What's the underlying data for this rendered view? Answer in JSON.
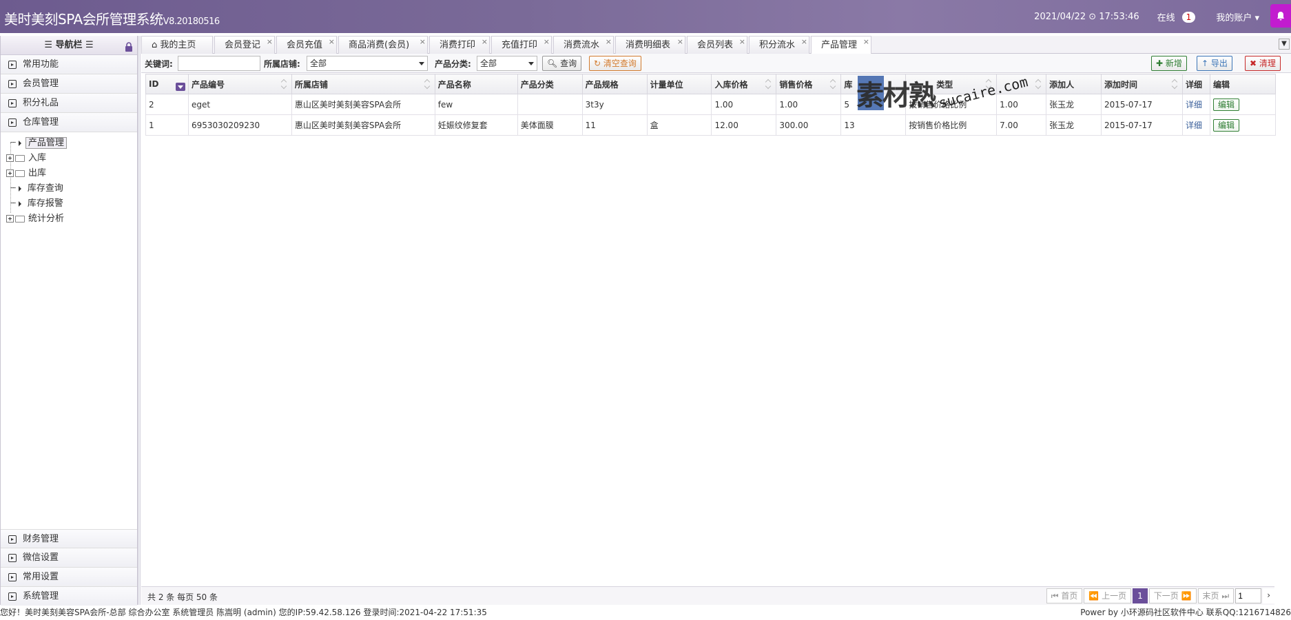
{
  "header": {
    "title": "美时美刻SPA会所管理系统",
    "version": "V8.20180516",
    "datetime": "2021/04/22 ⊙ 17:53:46",
    "online_label": "在线",
    "online_count": "1",
    "account_label": "我的账户"
  },
  "sidebar": {
    "title": "☰ 导航栏 ☰",
    "top_groups": [
      "常用功能",
      "会员管理",
      "积分礼品",
      "仓库管理"
    ],
    "tree": [
      "产品管理",
      "入库",
      "出库",
      "库存查询",
      "库存报警",
      "统计分析"
    ],
    "bottom_groups": [
      "财务管理",
      "微信设置",
      "常用设置",
      "系统管理"
    ]
  },
  "tabs": [
    "我的主页",
    "会员登记",
    "会员充值",
    "商品消费(会员)",
    "消费打印",
    "充值打印",
    "消费流水",
    "消费明细表",
    "会员列表",
    "积分流水",
    "产品管理"
  ],
  "toolbar": {
    "keyword_label": "关键词:",
    "store_label": "所属店铺:",
    "store_value": "全部",
    "category_label": "产品分类:",
    "category_value": "全部",
    "query_button": "查询",
    "clear_button": "清空查询",
    "add_button": "新增",
    "export_button": "导出",
    "clean_button": "清理"
  },
  "table": {
    "headers": [
      "ID",
      "产品编号",
      "所属店铺",
      "产品名称",
      "产品分类",
      "产品规格",
      "计量单位",
      "入库价格",
      "销售价格",
      "库",
      "类型",
      "",
      "添加人",
      "添加时间",
      "详细",
      "编辑"
    ],
    "rows": [
      [
        "2",
        "eget",
        "惠山区美时美刻美容SPA会所",
        "few",
        "",
        "3t3y",
        "",
        "1.00",
        "1.00",
        "5",
        "按销售价格比例",
        "1.00",
        "张玉龙",
        "2015-07-17",
        "详细",
        "编辑"
      ],
      [
        "1",
        "6953030209230",
        "惠山区美时美刻美容SPA会所",
        "妊娠纹修复套",
        "美体面膜",
        "11",
        "盒",
        "12.00",
        "300.00",
        "13",
        "按销售价格比例",
        "7.00",
        "张玉龙",
        "2015-07-17",
        "详细",
        "编辑"
      ]
    ]
  },
  "watermark": {
    "cn": "素材熟",
    "en": "sucaire.com"
  },
  "footer": {
    "summary": "共 2 条 每页 50 条",
    "first": "首页",
    "prev": "上一页",
    "current": "1",
    "next": "下一页",
    "last": "末页",
    "page_input": "1"
  },
  "statusbar": {
    "left": "您好！美时美刻美容SPA会所-总部 综合办公室 系统管理员 陈嵩明 (admin) 您的IP:59.42.58.126 登录时间:2021-04-22 17:51:35",
    "right": "Power by 小环源码社区软件中心 联系QQ:1216714826"
  },
  "colors": {
    "header": "#7a6a98",
    "accent": "#6b4f9a",
    "bell": "#c21ccf"
  }
}
